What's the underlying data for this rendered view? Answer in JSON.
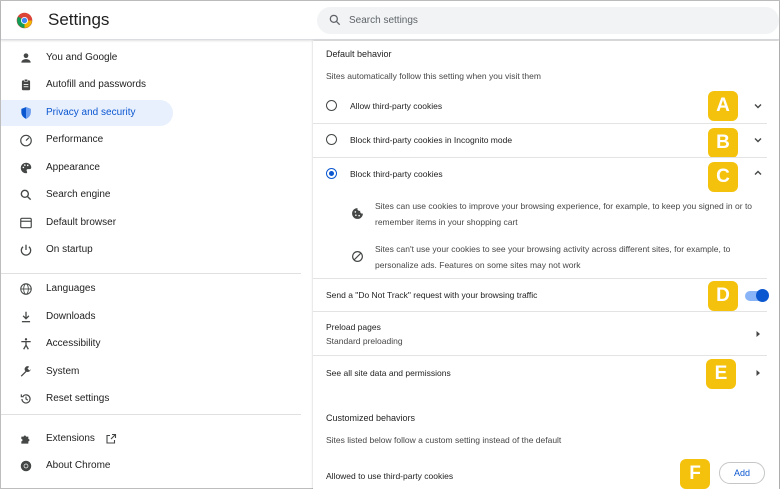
{
  "header": {
    "title": "Settings",
    "search_placeholder": "Search settings"
  },
  "sidebar": {
    "items": [
      {
        "label": "You and Google",
        "icon": "person-icon"
      },
      {
        "label": "Autofill and passwords",
        "icon": "clipboard-icon"
      },
      {
        "label": "Privacy and security",
        "icon": "shield-icon",
        "active": true
      },
      {
        "label": "Performance",
        "icon": "speedometer-icon"
      },
      {
        "label": "Appearance",
        "icon": "palette-icon"
      },
      {
        "label": "Search engine",
        "icon": "search-icon"
      },
      {
        "label": "Default browser",
        "icon": "browser-icon"
      },
      {
        "label": "On startup",
        "icon": "power-icon"
      },
      {
        "label": "Languages",
        "icon": "globe-icon"
      },
      {
        "label": "Downloads",
        "icon": "download-icon"
      },
      {
        "label": "Accessibility",
        "icon": "accessibility-icon"
      },
      {
        "label": "System",
        "icon": "wrench-icon"
      },
      {
        "label": "Reset settings",
        "icon": "history-icon"
      },
      {
        "label": "Extensions",
        "icon": "puzzle-icon"
      },
      {
        "label": "About Chrome",
        "icon": "chrome-icon"
      }
    ]
  },
  "main": {
    "default_behavior": {
      "heading": "Default behavior",
      "subtitle": "Sites automatically follow this setting when you visit them",
      "options": [
        {
          "label": "Allow third-party cookies",
          "selected": false,
          "badge": "A"
        },
        {
          "label": "Block third-party cookies in Incognito mode",
          "selected": false,
          "badge": "B"
        },
        {
          "label": "Block third-party cookies",
          "selected": true,
          "badge": "C"
        }
      ],
      "details": [
        {
          "icon": "cookie-icon",
          "text": "Sites can use cookies to improve your browsing experience, for example, to keep you signed in or to remember items in your shopping cart"
        },
        {
          "icon": "block-icon",
          "text": "Sites can't use your cookies to see your browsing activity across different sites, for example, to personalize ads. Features on some sites may not work"
        }
      ]
    },
    "do_not_track": {
      "label": "Send a \"Do Not Track\" request with your browsing traffic",
      "enabled": true,
      "badge": "D"
    },
    "preload": {
      "title": "Preload pages",
      "value": "Standard preloading"
    },
    "site_data": {
      "label": "See all site data and permissions",
      "badge": "E"
    },
    "customized": {
      "heading": "Customized behaviors",
      "subtitle": "Sites listed below follow a custom setting instead of the default",
      "allowed_label": "Allowed to use third-party cookies",
      "add_label": "Add",
      "badge": "F"
    }
  },
  "colors": {
    "accent": "#0b57d0",
    "badge": "#f4c20d",
    "active_nav_bg": "#e8f0fe"
  }
}
